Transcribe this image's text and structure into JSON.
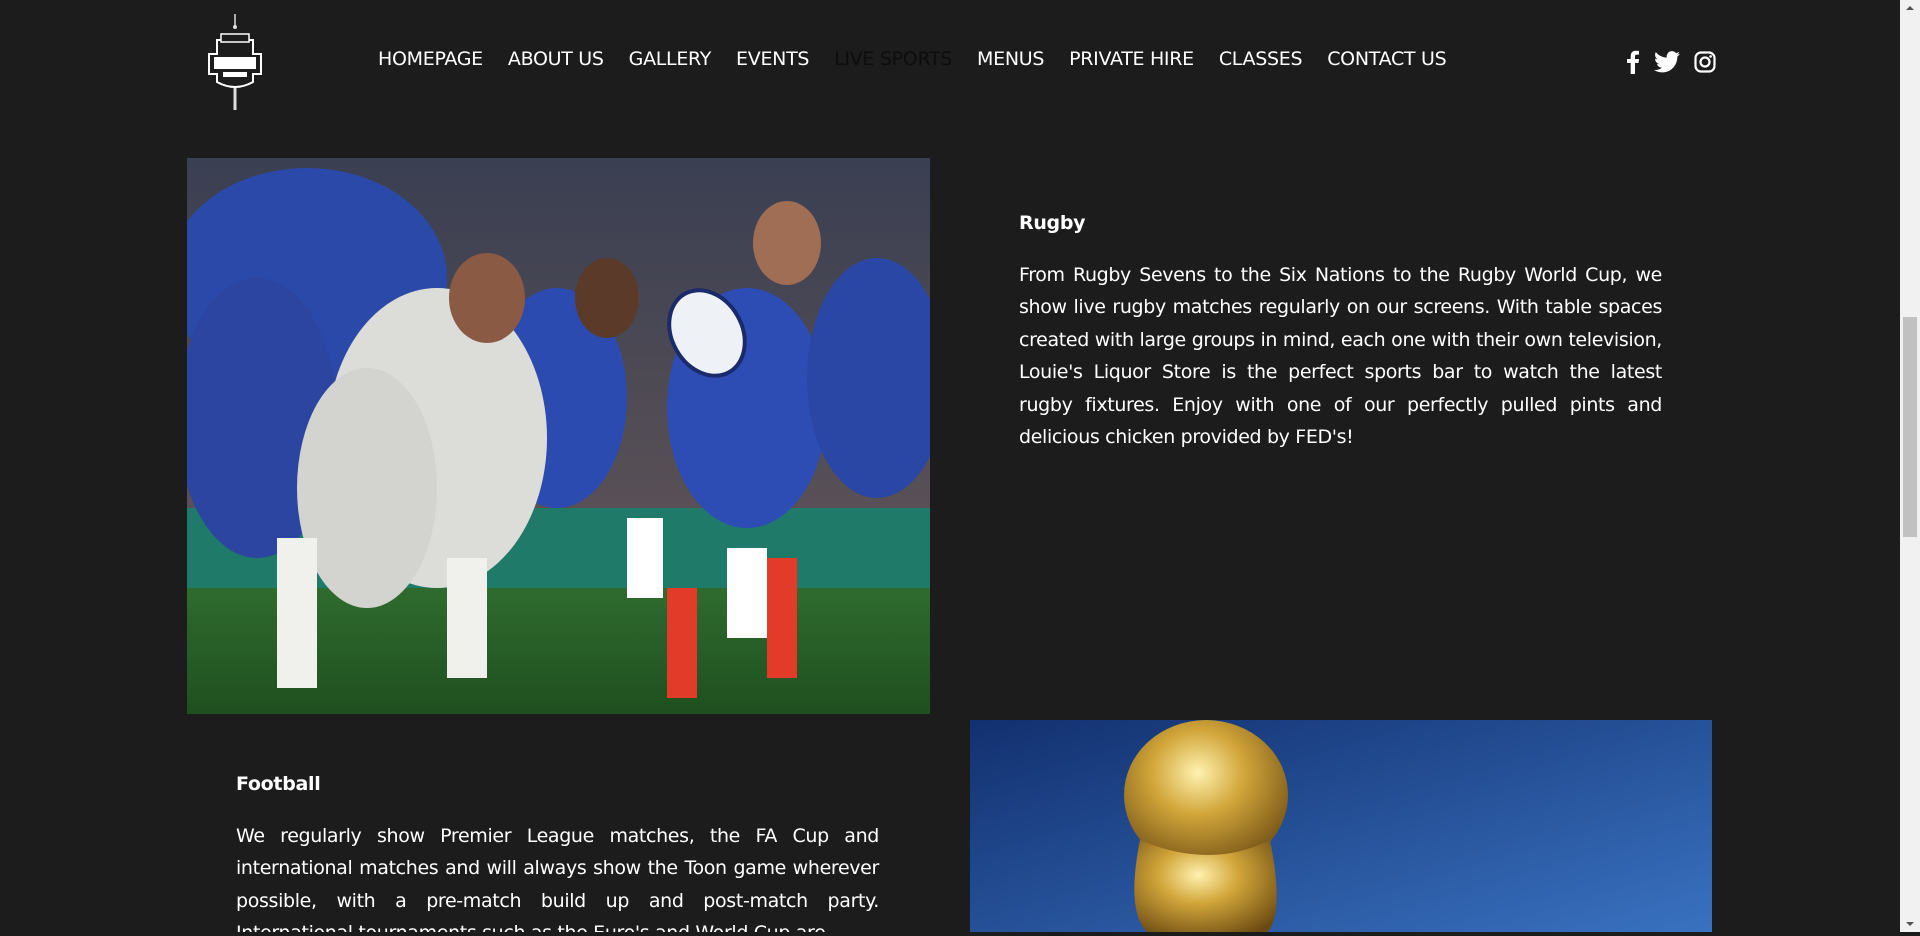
{
  "header": {
    "logo_alt": "Louie's Liquor Store",
    "nav": [
      {
        "label": "HOMEPAGE"
      },
      {
        "label": "ABOUT US"
      },
      {
        "label": "GALLERY"
      },
      {
        "label": "EVENTS"
      },
      {
        "label": "LIVE SPORTS",
        "active": true
      },
      {
        "label": "MENUS"
      },
      {
        "label": "PRIVATE HIRE"
      },
      {
        "label": "CLASSES"
      },
      {
        "label": "CONTACT US"
      }
    ],
    "social_icons": [
      "facebook-icon",
      "twitter-icon",
      "instagram-icon"
    ]
  },
  "sections": {
    "rugby": {
      "title": "Rugby",
      "body": "From Rugby Sevens to the Six Nations to the Rugby World Cup, we show live rugby matches regularly on our screens. With table spaces created with large groups in mind, each one with their own television, Louie's Liquor Store is the perfect sports bar to watch the latest rugby fixtures. Enjoy with one of our perfectly pulled pints and delicious chicken provided by FED's!"
    },
    "football": {
      "title": "Football",
      "body": "We regularly show Premier League matches, the FA Cup and international matches and will always show the Toon game wherever possible, with a pre-match build up and post-match party. International tournaments such as the Euro's and World Cup are"
    }
  },
  "colors": {
    "background": "#1c1c1c",
    "text": "#ffffff",
    "active_nav": "#0d0d0d"
  }
}
